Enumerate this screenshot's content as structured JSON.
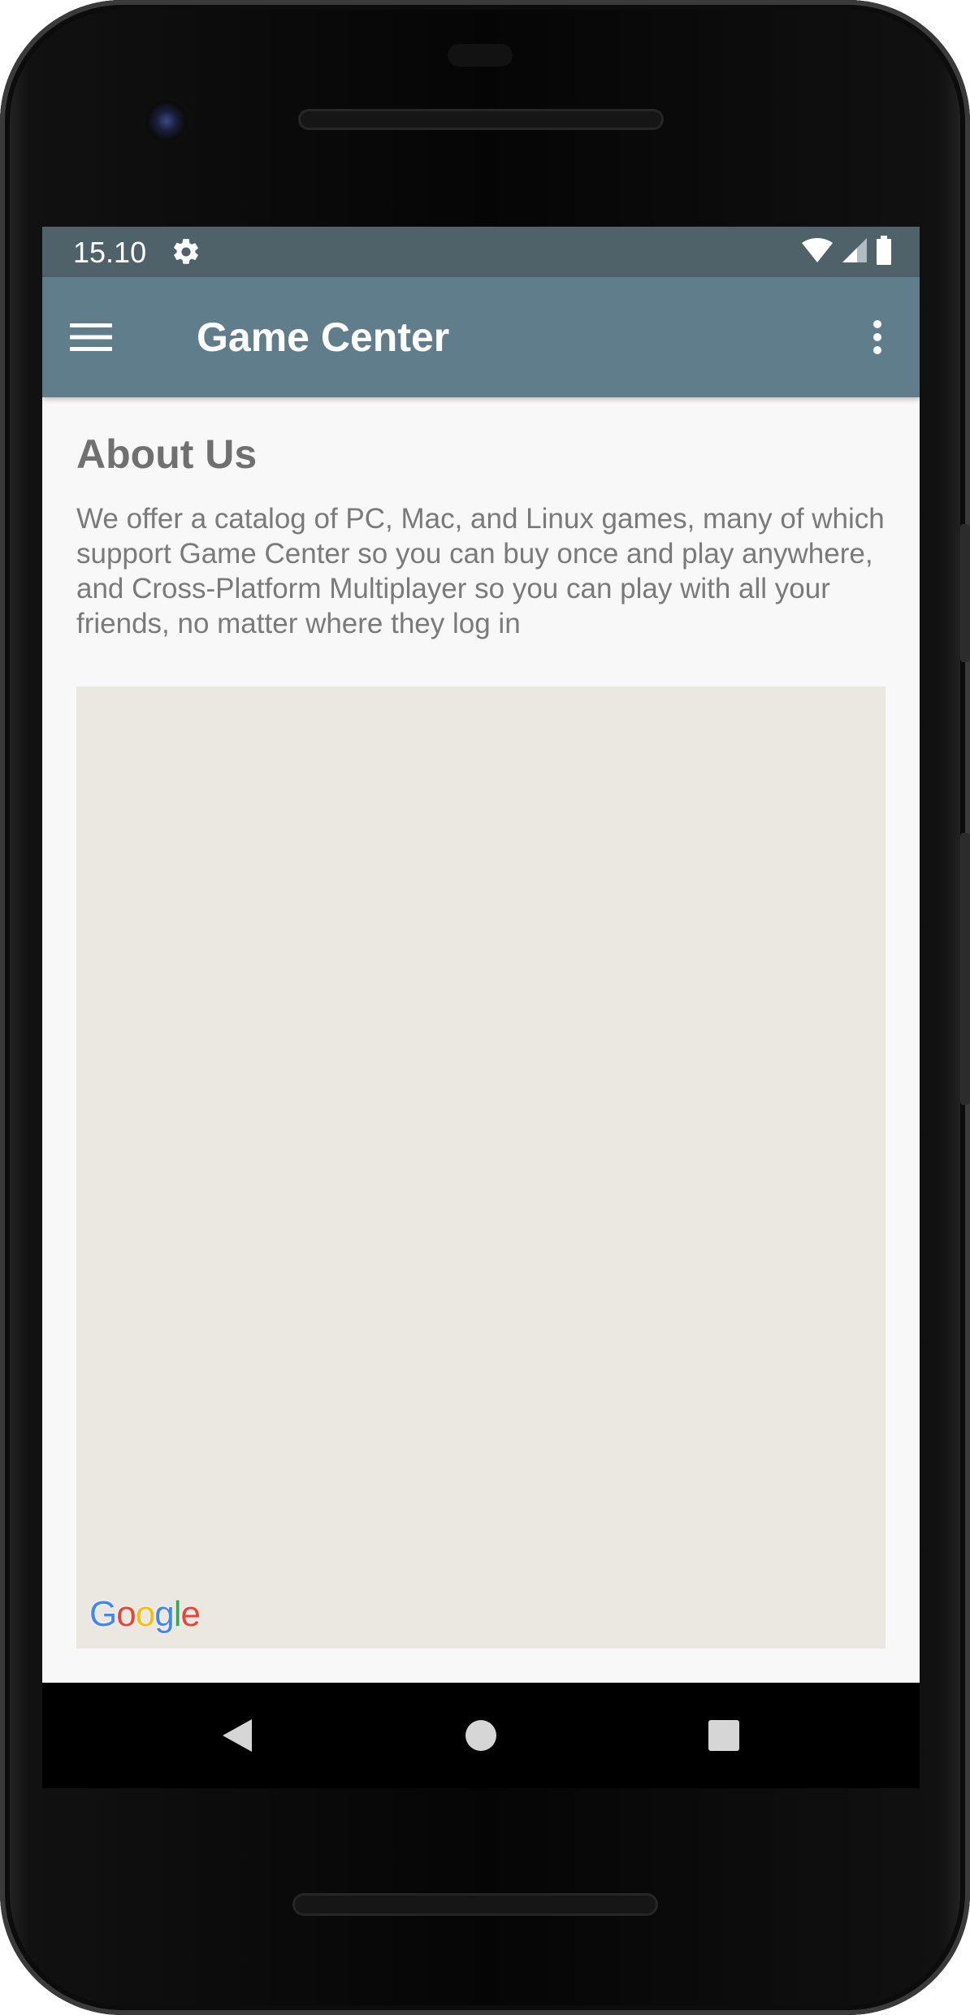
{
  "status_bar": {
    "time": "15.10",
    "icons": [
      "gear-icon",
      "wifi-icon",
      "cellular-signal-icon",
      "battery-icon"
    ]
  },
  "app_bar": {
    "title": "Game Center",
    "menu_icon": "hamburger-menu-icon",
    "overflow_icon": "more-vert-icon",
    "color": "#607d8b"
  },
  "content": {
    "heading": "About Us",
    "body": "We offer a catalog of PC, Mac, and Linux games, many of which support Game Center so you can buy once and play anywhere, and Cross-Platform Multiplayer so you can play with all your friends, no matter where they log in"
  },
  "map": {
    "logo_letters": [
      "G",
      "o",
      "o",
      "g",
      "l",
      "e"
    ],
    "logo_colors": [
      "#4285F4",
      "#EA4335",
      "#FBBC05",
      "#4285F4",
      "#34A853",
      "#EA4335"
    ],
    "background": "#ebe8e1"
  },
  "nav_bar": {
    "icons": [
      "back-icon",
      "home-icon",
      "recents-icon"
    ]
  }
}
